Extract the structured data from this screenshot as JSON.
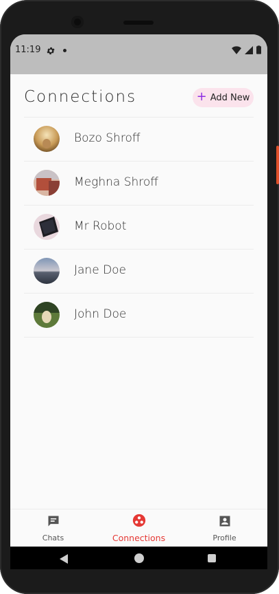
{
  "status_bar": {
    "time": "11:19",
    "icons": [
      "gear-icon",
      "dot-icon",
      "wifi-icon",
      "signal-icon",
      "battery-icon"
    ]
  },
  "header": {
    "title": "Connections",
    "add_button_label": "Add New"
  },
  "contacts": [
    {
      "name": "Bozo Shroff",
      "avatar": "photo-dog-field"
    },
    {
      "name": "Meghna Shroff",
      "avatar": "photo-rooftop"
    },
    {
      "name": "Mr Robot",
      "avatar": "photo-tablet"
    },
    {
      "name": "Jane Doe",
      "avatar": "photo-seascape"
    },
    {
      "name": "John Doe",
      "avatar": "photo-dog-grass"
    }
  ],
  "bottom_nav": {
    "items": [
      {
        "label": "Chats",
        "icon": "chat-icon",
        "active": false
      },
      {
        "label": "Connections",
        "icon": "connections-icon",
        "active": true
      },
      {
        "label": "Profile",
        "icon": "profile-icon",
        "active": false
      }
    ]
  },
  "colors": {
    "accent_red": "#e53935",
    "add_button_bg": "#fbe3ec",
    "plus_purple": "#8e2de2",
    "status_bar_bg": "#bdbdbd"
  }
}
